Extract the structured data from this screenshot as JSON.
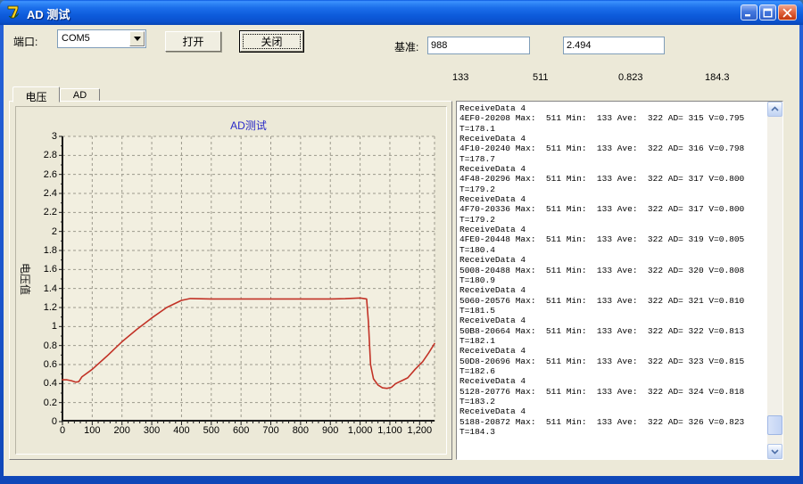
{
  "window": {
    "title": "AD 测试"
  },
  "toolbar": {
    "port_label": "端口:",
    "port_value": "COM5",
    "open_button": "打开",
    "close_button": "关闭",
    "base_label": "基准:",
    "base_value_1": "988",
    "base_value_2": "2.494"
  },
  "stats": [
    "133",
    "511",
    "0.823",
    "184.3"
  ],
  "tabs": [
    {
      "label": "电压"
    },
    {
      "label": "AD"
    }
  ],
  "chart_data": {
    "type": "line",
    "title": "AD测试",
    "ylabel": "电压值",
    "xlim": [
      0,
      1250
    ],
    "ylim": [
      0,
      3
    ],
    "grid": "dashed",
    "x_tick_values": [
      0,
      100,
      200,
      300,
      400,
      500,
      600,
      700,
      800,
      900,
      1000,
      1100,
      1200
    ],
    "x_tick_labels": [
      "0",
      "100",
      "200",
      "300",
      "400",
      "500",
      "600",
      "700",
      "800",
      "900",
      "1,000",
      "1,100",
      "1,200"
    ],
    "y_tick_values": [
      0,
      0.2,
      0.4,
      0.6,
      0.8,
      1,
      1.2,
      1.4,
      1.6,
      1.8,
      2,
      2.2,
      2.4,
      2.6,
      2.8,
      3
    ],
    "y_tick_labels": [
      "0",
      "0.2",
      "0.4",
      "0.6",
      "0.8",
      "1",
      "1.2",
      "1.4",
      "1.6",
      "1.8",
      "2",
      "2.2",
      "2.4",
      "2.6",
      "2.8",
      "3"
    ],
    "series": [
      {
        "name": "电压",
        "color": "#C23226",
        "points": [
          [
            0,
            0.44
          ],
          [
            15,
            0.44
          ],
          [
            30,
            0.43
          ],
          [
            45,
            0.415
          ],
          [
            55,
            0.42
          ],
          [
            65,
            0.47
          ],
          [
            100,
            0.55
          ],
          [
            150,
            0.69
          ],
          [
            200,
            0.84
          ],
          [
            250,
            0.97
          ],
          [
            300,
            1.09
          ],
          [
            350,
            1.2
          ],
          [
            400,
            1.275
          ],
          [
            430,
            1.295
          ],
          [
            500,
            1.29
          ],
          [
            600,
            1.29
          ],
          [
            700,
            1.29
          ],
          [
            800,
            1.29
          ],
          [
            900,
            1.29
          ],
          [
            950,
            1.293
          ],
          [
            1000,
            1.3
          ],
          [
            1022,
            1.29
          ],
          [
            1028,
            1.05
          ],
          [
            1035,
            0.6
          ],
          [
            1045,
            0.45
          ],
          [
            1060,
            0.385
          ],
          [
            1075,
            0.355
          ],
          [
            1090,
            0.35
          ],
          [
            1105,
            0.36
          ],
          [
            1120,
            0.4
          ],
          [
            1140,
            0.43
          ],
          [
            1160,
            0.46
          ],
          [
            1185,
            0.55
          ],
          [
            1210,
            0.63
          ],
          [
            1230,
            0.72
          ],
          [
            1250,
            0.82
          ]
        ]
      }
    ]
  },
  "log": {
    "lines": [
      "ReceiveData 4",
      "4EF0-20208 Max:  511 Min:  133 Ave:  322 AD= 315 V=0.795",
      "T=178.1",
      "ReceiveData 4",
      "4F10-20240 Max:  511 Min:  133 Ave:  322 AD= 316 V=0.798",
      "T=178.7",
      "ReceiveData 4",
      "4F48-20296 Max:  511 Min:  133 Ave:  322 AD= 317 V=0.800",
      "T=179.2",
      "ReceiveData 4",
      "4F70-20336 Max:  511 Min:  133 Ave:  322 AD= 317 V=0.800",
      "T=179.2",
      "ReceiveData 4",
      "4FE0-20448 Max:  511 Min:  133 Ave:  322 AD= 319 V=0.805",
      "T=180.4",
      "ReceiveData 4",
      "5008-20488 Max:  511 Min:  133 Ave:  322 AD= 320 V=0.808",
      "T=180.9",
      "ReceiveData 4",
      "5060-20576 Max:  511 Min:  133 Ave:  322 AD= 321 V=0.810",
      "T=181.5",
      "ReceiveData 4",
      "50B8-20664 Max:  511 Min:  133 Ave:  322 AD= 322 V=0.813",
      "T=182.1",
      "ReceiveData 4",
      "50D8-20696 Max:  511 Min:  133 Ave:  322 AD= 323 V=0.815",
      "T=182.6",
      "ReceiveData 4",
      "5128-20776 Max:  511 Min:  133 Ave:  322 AD= 324 V=0.818",
      "T=183.2",
      "ReceiveData 4",
      "5188-20872 Max:  511 Min:  133 Ave:  322 AD= 326 V=0.823",
      "T=184.3"
    ]
  }
}
